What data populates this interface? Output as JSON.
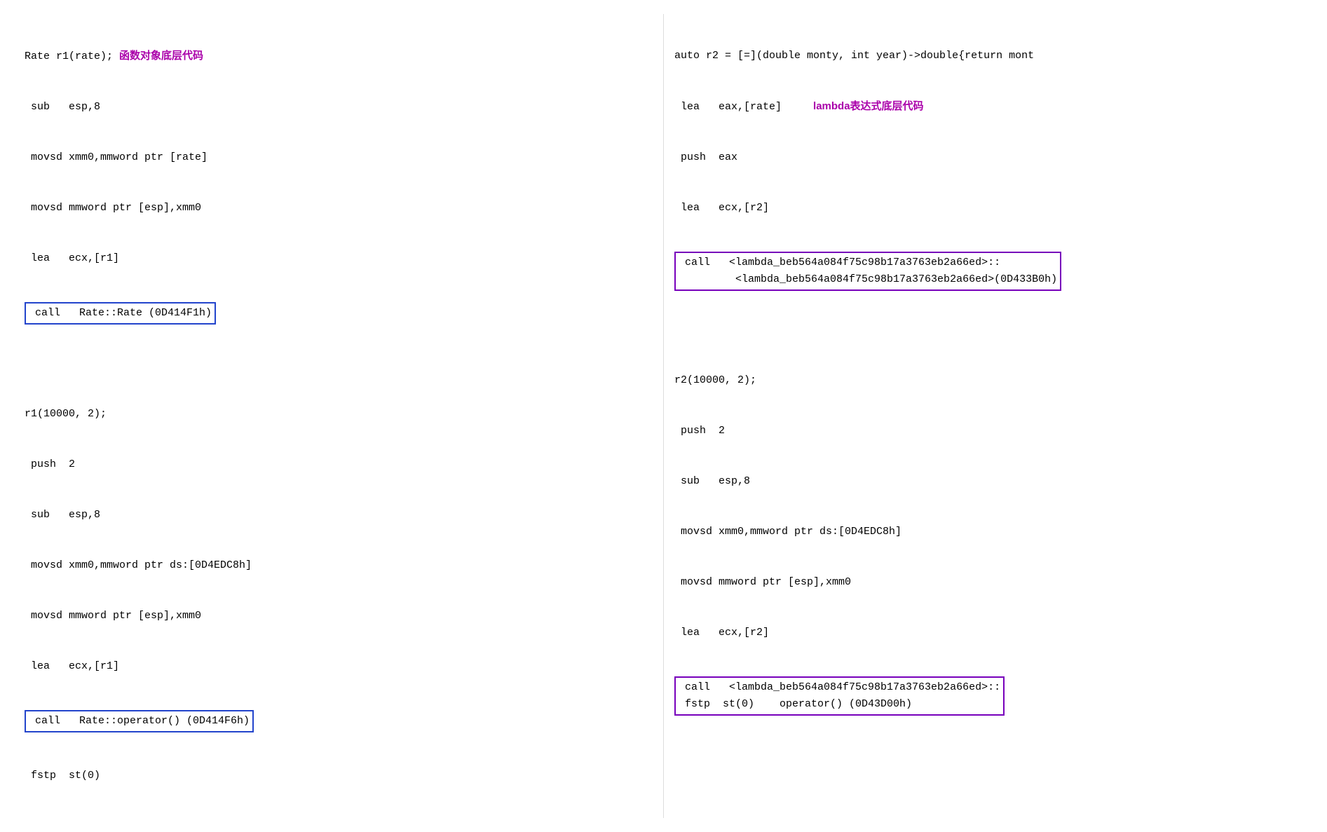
{
  "left": {
    "block1": {
      "lines": [
        {
          "text": "Rate r1(rate); ",
          "label": "函数对象底层代码",
          "labelClass": "comment-label"
        },
        {
          "text": " sub   esp,8"
        },
        {
          "text": " movsd xmm0,mmword ptr [rate]"
        },
        {
          "text": " movsd mmword ptr [esp],xmm0"
        },
        {
          "text": " lea   ecx,[r1]"
        },
        {
          "call": "call   Rate::Rate (0D414F1h)",
          "boxClass": "highlighted-call-blue"
        }
      ]
    },
    "block2": {
      "lines": [
        {
          "text": ""
        },
        {
          "text": "r1(10000, 2);"
        },
        {
          "text": ""
        },
        {
          "text": " push  2"
        },
        {
          "text": " sub   esp,8"
        },
        {
          "text": " movsd xmm0,mmword ptr ds:[0D4EDC8h]"
        },
        {
          "text": " movsd mmword ptr [esp],xmm0"
        },
        {
          "text": " lea   ecx,[r1]"
        },
        {
          "call": "call   Rate::operator() (0D414F6h)",
          "boxClass": "highlighted-call-blue"
        },
        {
          "text": " fstp  st(0)"
        }
      ]
    }
  },
  "right": {
    "block1": {
      "lines": [
        {
          "text": "auto r2 = [=](double monty, int year)->double{return mont"
        },
        {
          "text": " lea   eax,[rate]     ",
          "label": "lambda表达式底层代码",
          "labelClass": "comment-label"
        },
        {
          "text": " push  eax"
        },
        {
          "text": " lea   ecx,[r2]"
        },
        {
          "call": "call   <lambda_beb564a084f75c98b17a3763eb2a66ed>::\n         <lambda_beb564a084f75c98b17a3763eb2a66ed>(0D433B0h)",
          "boxClass": "highlighted-call"
        }
      ]
    },
    "block2": {
      "lines": [
        {
          "text": ""
        },
        {
          "text": "r2(10000, 2);"
        },
        {
          "text": ""
        },
        {
          "text": " push  2"
        },
        {
          "text": " sub   esp,8"
        },
        {
          "text": " movsd xmm0,mmword ptr ds:[0D4EDC8h]"
        },
        {
          "text": " movsd mmword ptr [esp],xmm0"
        },
        {
          "text": " lea   ecx,[r2]"
        },
        {
          "call": "call   <lambda_beb564a084f75c98b17a3763eb2a66ed>::\n fstp  st(0)    operator() (0D43D00h)",
          "boxClass": "highlighted-call"
        }
      ]
    }
  }
}
